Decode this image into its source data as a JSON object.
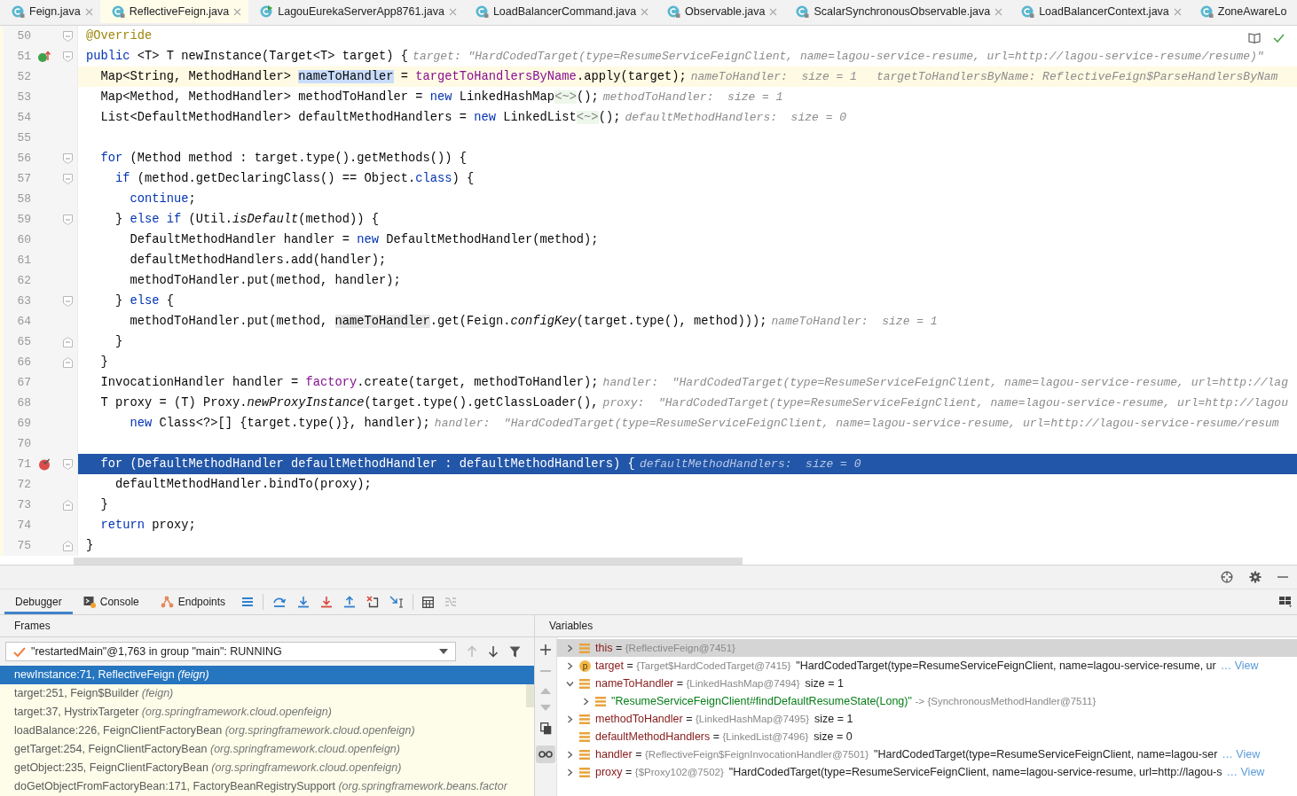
{
  "tabs": [
    {
      "label": "Feign.java",
      "kind": "class",
      "selected": false,
      "closable": true
    },
    {
      "label": "ReflectiveFeign.java",
      "kind": "class",
      "selected": true,
      "closable": true
    },
    {
      "label": "LagouEurekaServerApp8761.java",
      "kind": "app",
      "selected": false,
      "closable": true
    },
    {
      "label": "LoadBalancerCommand.java",
      "kind": "class",
      "selected": false,
      "closable": true
    },
    {
      "label": "Observable.java",
      "kind": "class",
      "selected": false,
      "closable": true
    },
    {
      "label": "ScalarSynchronousObservable.java",
      "kind": "class",
      "selected": false,
      "closable": true
    },
    {
      "label": "LoadBalancerContext.java",
      "kind": "class",
      "selected": false,
      "closable": true
    },
    {
      "label": "ZoneAwareLo",
      "kind": "class",
      "selected": false,
      "closable": false
    }
  ],
  "editor": {
    "lines": [
      {
        "number": "50",
        "current": false,
        "selected": false,
        "breakpoint": false,
        "override": false,
        "fold_start": true,
        "fold_end": false,
        "tokens": [
          {
            "kind": "annotation",
            "text": "@Override"
          }
        ]
      },
      {
        "number": "51",
        "current": false,
        "selected": false,
        "breakpoint": false,
        "override": true,
        "fold_start": true,
        "fold_end": false,
        "tokens": [
          {
            "kind": "keyword",
            "text": "public "
          },
          {
            "kind": "plain",
            "text": "<T> T newInstance(Target<T> target) {"
          }
        ],
        "hints": [
          "target: \"HardCodedTarget(type=ResumeServiceFeignClient, name=lagou-service-resume, url=http://lagou-service-resume/resume)\""
        ]
      },
      {
        "number": "52",
        "current": true,
        "selected": false,
        "breakpoint": false,
        "override": false,
        "fold_start": false,
        "fold_end": false,
        "tokens": [
          {
            "kind": "plain",
            "text": "  Map<String, MethodHandler> "
          },
          {
            "kind": "declaration",
            "text": "nameToHandler"
          },
          {
            "kind": "plain",
            "text": " = "
          },
          {
            "kind": "field",
            "text": "targetToHandlersByName"
          },
          {
            "kind": "plain",
            "text": ".apply(target);"
          }
        ],
        "hints": [
          "nameToHandler:  size = 1",
          "targetToHandlersByName: ReflectiveFeign$ParseHandlersByNam"
        ]
      },
      {
        "number": "53",
        "current": false,
        "selected": false,
        "breakpoint": false,
        "override": false,
        "fold_start": false,
        "fold_end": false,
        "tokens": [
          {
            "kind": "plain",
            "text": "  Map<Method, MethodHandler> methodToHandler = "
          },
          {
            "kind": "keyword",
            "text": "new"
          },
          {
            "kind": "plain",
            "text": " LinkedHashMap"
          },
          {
            "kind": "diamond",
            "text": "<~>"
          },
          {
            "kind": "plain",
            "text": "();"
          }
        ],
        "hints": [
          "methodToHandler:  size = 1"
        ]
      },
      {
        "number": "54",
        "current": false,
        "selected": false,
        "breakpoint": false,
        "override": false,
        "fold_start": false,
        "fold_end": false,
        "tokens": [
          {
            "kind": "plain",
            "text": "  List<DefaultMethodHandler> defaultMethodHandlers = "
          },
          {
            "kind": "keyword",
            "text": "new"
          },
          {
            "kind": "plain",
            "text": " LinkedList"
          },
          {
            "kind": "diamond",
            "text": "<~>"
          },
          {
            "kind": "plain",
            "text": "();"
          }
        ],
        "hints": [
          "defaultMethodHandlers:  size = 0"
        ]
      },
      {
        "number": "55",
        "current": false,
        "selected": false,
        "breakpoint": false,
        "override": false,
        "fold_start": false,
        "fold_end": false
      },
      {
        "number": "56",
        "current": false,
        "selected": false,
        "breakpoint": false,
        "override": false,
        "fold_start": true,
        "fold_end": false,
        "tokens": [
          {
            "kind": "keyword",
            "text": "  for"
          },
          {
            "kind": "plain",
            "text": " (Method method : target.type().getMethods()) {"
          }
        ]
      },
      {
        "number": "57",
        "current": false,
        "selected": false,
        "breakpoint": false,
        "override": false,
        "fold_start": true,
        "fold_end": false,
        "tokens": [
          {
            "kind": "keyword",
            "text": "    if"
          },
          {
            "kind": "plain",
            "text": " (method.getDeclaringClass() == Object."
          },
          {
            "kind": "keyword",
            "text": "class"
          },
          {
            "kind": "plain",
            "text": ") {"
          }
        ]
      },
      {
        "number": "58",
        "current": false,
        "selected": false,
        "breakpoint": false,
        "override": false,
        "fold_start": false,
        "fold_end": false,
        "tokens": [
          {
            "kind": "keyword",
            "text": "      continue"
          },
          {
            "kind": "plain",
            "text": ";"
          }
        ]
      },
      {
        "number": "59",
        "current": false,
        "selected": false,
        "breakpoint": false,
        "override": false,
        "fold_start": true,
        "fold_end": false,
        "tokens": [
          {
            "kind": "plain",
            "text": "    } "
          },
          {
            "kind": "keyword",
            "text": "else if"
          },
          {
            "kind": "plain",
            "text": " (Util."
          },
          {
            "kind": "static",
            "text": "isDefault"
          },
          {
            "kind": "plain",
            "text": "(method)) {"
          }
        ]
      },
      {
        "number": "60",
        "current": false,
        "selected": false,
        "breakpoint": false,
        "override": false,
        "fold_start": false,
        "fold_end": false,
        "tokens": [
          {
            "kind": "plain",
            "text": "      DefaultMethodHandler handler = "
          },
          {
            "kind": "keyword",
            "text": "new"
          },
          {
            "kind": "plain",
            "text": " DefaultMethodHandler(method);"
          }
        ]
      },
      {
        "number": "61",
        "current": false,
        "selected": false,
        "breakpoint": false,
        "override": false,
        "fold_start": false,
        "fold_end": false,
        "tokens": [
          {
            "kind": "plain",
            "text": "      defaultMethodHandlers.add(handler);"
          }
        ]
      },
      {
        "number": "62",
        "current": false,
        "selected": false,
        "breakpoint": false,
        "override": false,
        "fold_start": false,
        "fold_end": false,
        "tokens": [
          {
            "kind": "plain",
            "text": "      methodToHandler.put(method, handler);"
          }
        ]
      },
      {
        "number": "63",
        "current": false,
        "selected": false,
        "breakpoint": false,
        "override": false,
        "fold_start": true,
        "fold_end": false,
        "tokens": [
          {
            "kind": "plain",
            "text": "    } "
          },
          {
            "kind": "keyword",
            "text": "else"
          },
          {
            "kind": "plain",
            "text": " {"
          }
        ]
      },
      {
        "number": "64",
        "current": false,
        "selected": false,
        "breakpoint": false,
        "override": false,
        "fold_start": false,
        "fold_end": false,
        "tokens": [
          {
            "kind": "plain",
            "text": "      methodToHandler.put(method, "
          },
          {
            "kind": "usage",
            "text": "nameToHandler"
          },
          {
            "kind": "plain",
            "text": ".get(Feign."
          },
          {
            "kind": "static",
            "text": "configKey"
          },
          {
            "kind": "plain",
            "text": "(target.type(), method)));"
          }
        ],
        "hints": [
          "nameToHandler:  size = 1"
        ]
      },
      {
        "number": "65",
        "current": false,
        "selected": false,
        "breakpoint": false,
        "override": false,
        "fold_start": false,
        "fold_end": true,
        "tokens": [
          {
            "kind": "plain",
            "text": "    }"
          }
        ]
      },
      {
        "number": "66",
        "current": false,
        "selected": false,
        "breakpoint": false,
        "override": false,
        "fold_start": false,
        "fold_end": true,
        "tokens": [
          {
            "kind": "plain",
            "text": "  }"
          }
        ]
      },
      {
        "number": "67",
        "current": false,
        "selected": false,
        "breakpoint": false,
        "override": false,
        "fold_start": false,
        "fold_end": false,
        "tokens": [
          {
            "kind": "plain",
            "text": "  InvocationHandler handler = "
          },
          {
            "kind": "field",
            "text": "factory"
          },
          {
            "kind": "plain",
            "text": ".create(target, methodToHandler);"
          }
        ],
        "hints": [
          "handler:  \"HardCodedTarget(type=ResumeServiceFeignClient, name=lagou-service-resume, url=http://lag"
        ]
      },
      {
        "number": "68",
        "current": false,
        "selected": false,
        "breakpoint": false,
        "override": false,
        "fold_start": false,
        "fold_end": false,
        "tokens": [
          {
            "kind": "plain",
            "text": "  T proxy = (T) Proxy."
          },
          {
            "kind": "static",
            "text": "newProxyInstance"
          },
          {
            "kind": "plain",
            "text": "(target.type().getClassLoader(),"
          }
        ],
        "hints": [
          "proxy:  \"HardCodedTarget(type=ResumeServiceFeignClient, name=lagou-service-resume, url=http://lagou"
        ]
      },
      {
        "number": "69",
        "current": false,
        "selected": false,
        "breakpoint": false,
        "override": false,
        "fold_start": false,
        "fold_end": false,
        "tokens": [
          {
            "kind": "keyword",
            "text": "      new"
          },
          {
            "kind": "plain",
            "text": " Class<?>[] {target.type()}, handler);"
          }
        ],
        "hints": [
          "handler:  \"HardCodedTarget(type=ResumeServiceFeignClient, name=lagou-service-resume, url=http://lagou-service-resume/resum"
        ]
      },
      {
        "number": "70",
        "current": false,
        "selected": false,
        "breakpoint": false,
        "override": false,
        "fold_start": false,
        "fold_end": false
      },
      {
        "number": "71",
        "current": false,
        "selected": true,
        "breakpoint": true,
        "override": false,
        "fold_start": true,
        "fold_end": false,
        "tokens": [
          {
            "kind": "keyword",
            "text": "  for"
          },
          {
            "kind": "plain",
            "text": " (DefaultMethodHandler defaultMethodHandler : defaultMethodHandlers) {"
          }
        ],
        "hints": [
          "defaultMethodHandlers:  size = 0"
        ]
      },
      {
        "number": "72",
        "current": false,
        "selected": false,
        "breakpoint": false,
        "override": false,
        "fold_start": false,
        "fold_end": false,
        "tokens": [
          {
            "kind": "plain",
            "text": "    defaultMethodHandler.bindTo(proxy);"
          }
        ]
      },
      {
        "number": "73",
        "current": false,
        "selected": false,
        "breakpoint": false,
        "override": false,
        "fold_start": false,
        "fold_end": true,
        "tokens": [
          {
            "kind": "plain",
            "text": "  }"
          }
        ]
      },
      {
        "number": "74",
        "current": false,
        "selected": false,
        "breakpoint": false,
        "override": false,
        "fold_start": false,
        "fold_end": false,
        "tokens": [
          {
            "kind": "keyword",
            "text": "  return"
          },
          {
            "kind": "plain",
            "text": " proxy;"
          }
        ]
      },
      {
        "number": "75",
        "current": false,
        "selected": false,
        "breakpoint": false,
        "override": false,
        "fold_start": false,
        "fold_end": true,
        "tokens": [
          {
            "kind": "plain",
            "text": "}"
          }
        ]
      }
    ]
  },
  "debug_tabs": [
    {
      "label": "Debugger",
      "kind": "plain",
      "selected": true
    },
    {
      "label": "Console",
      "kind": "console",
      "selected": false
    },
    {
      "label": "Endpoints",
      "kind": "endpoints",
      "selected": false
    }
  ],
  "frames": {
    "title": "Frames",
    "thread": "\"restartedMain\"@1,763 in group \"main\": RUNNING",
    "items": [
      {
        "method": "newInstance:71, ReflectiveFeign",
        "package": "(feign)",
        "selected": true
      },
      {
        "method": "target:251, Feign$Builder",
        "package": "(feign)",
        "selected": false
      },
      {
        "method": "target:37, HystrixTargeter",
        "package": "(org.springframework.cloud.openfeign)",
        "selected": false
      },
      {
        "method": "loadBalance:226, FeignClientFactoryBean",
        "package": "(org.springframework.cloud.openfeign)",
        "selected": false
      },
      {
        "method": "getTarget:254, FeignClientFactoryBean",
        "package": "(org.springframework.cloud.openfeign)",
        "selected": false
      },
      {
        "method": "getObject:235, FeignClientFactoryBean",
        "package": "(org.springframework.cloud.openfeign)",
        "selected": false
      },
      {
        "method": "doGetObjectFromFactoryBean:171, FactoryBeanRegistrySupport",
        "package": "(org.springframework.beans.factor",
        "selected": false
      }
    ]
  },
  "variables": {
    "title": "Variables",
    "items": [
      {
        "kind": "field",
        "name": "this",
        "separator": "=",
        "type": "{ReflectiveFeign@7451}",
        "selected": true,
        "expanded": false
      },
      {
        "kind": "parameter",
        "badge": "p",
        "name": "target",
        "separator": "=",
        "type": "{Target$HardCodedTarget@7415}",
        "value": "\"HardCodedTarget(type=ResumeServiceFeignClient, name=lagou-service-resume, ur",
        "link": "… View",
        "selected": false,
        "expanded": false
      },
      {
        "kind": "field",
        "name": "nameToHandler",
        "separator": "=",
        "type": "{LinkedHashMap@7494}",
        "value": "size = 1",
        "selected": false,
        "expanded": true,
        "children": [
          {
            "kind": "entry",
            "name": "\"ResumeServiceFeignClient#findDefaultResumeState(Long)\"",
            "separator": "->",
            "type": "{SynchronousMethodHandler@7511}",
            "selected": false,
            "expanded": false
          }
        ]
      },
      {
        "kind": "field",
        "name": "methodToHandler",
        "separator": "=",
        "type": "{LinkedHashMap@7495}",
        "value": "size = 1",
        "selected": false,
        "expanded": false
      },
      {
        "kind": "field",
        "name": "defaultMethodHandlers",
        "separator": "=",
        "type": "{LinkedList@7496}",
        "value": "size = 0",
        "selected": false
      },
      {
        "kind": "field",
        "name": "handler",
        "separator": "=",
        "type": "{ReflectiveFeign$FeignInvocationHandler@7501}",
        "value": "\"HardCodedTarget(type=ResumeServiceFeignClient, name=lagou-ser",
        "link": "… View",
        "selected": false,
        "expanded": false
      },
      {
        "kind": "field",
        "name": "proxy",
        "separator": "=",
        "type": "{$Proxy102@7502}",
        "value": "\"HardCodedTarget(type=ResumeServiceFeignClient, name=lagou-service-resume, url=http://lagou-s",
        "link": "… View",
        "selected": false,
        "expanded": false
      }
    ]
  }
}
